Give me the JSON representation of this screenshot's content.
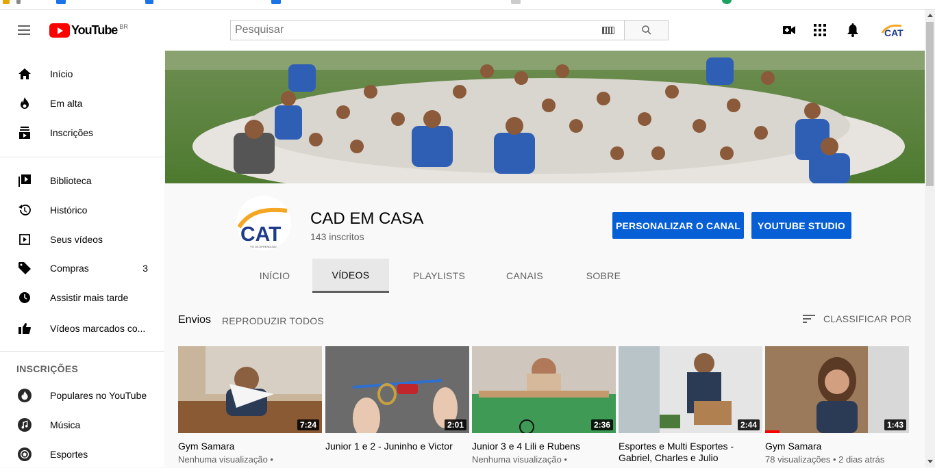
{
  "header": {
    "logo_text": "YouTube",
    "country_code": "BR",
    "search_placeholder": "Pesquisar"
  },
  "sidebar": {
    "main": [
      {
        "label": "Início",
        "icon": "home-icon"
      },
      {
        "label": "Em alta",
        "icon": "flame-icon"
      },
      {
        "label": "Inscrições",
        "icon": "subscriptions-icon"
      }
    ],
    "library": [
      {
        "label": "Biblioteca",
        "icon": "library-icon"
      },
      {
        "label": "Histórico",
        "icon": "history-icon"
      },
      {
        "label": "Seus vídeos",
        "icon": "play-square-icon"
      },
      {
        "label": "Compras",
        "icon": "tag-icon",
        "count": "3"
      },
      {
        "label": "Assistir mais tarde",
        "icon": "clock-icon"
      },
      {
        "label": "Vídeos marcados co...",
        "icon": "thumbs-up-icon"
      }
    ],
    "subscriptions_heading": "INSCRIÇÕES",
    "subscriptions": [
      {
        "label": "Populares no YouTube",
        "icon": "popular-icon"
      },
      {
        "label": "Música",
        "icon": "music-icon"
      },
      {
        "label": "Esportes",
        "icon": "sports-icon"
      }
    ]
  },
  "channel": {
    "name": "CAD EM CASA",
    "subscribers": "143 inscritos",
    "avatar_text": "CAT",
    "avatar_caption": "RO DE APRENDIZAD",
    "customize_label": "PERSONALIZAR O CANAL",
    "studio_label": "YOUTUBE STUDIO",
    "tabs": [
      "INÍCIO",
      "VÍDEOS",
      "PLAYLISTS",
      "CANAIS",
      "SOBRE"
    ],
    "active_tab": "VÍDEOS"
  },
  "uploads": {
    "title": "Envios",
    "play_all": "REPRODUZIR TODOS",
    "sort_label": "CLASSIFICAR POR",
    "videos": [
      {
        "title": "Gym Samara",
        "duration": "7:24",
        "meta": "Nenhuma visualização •"
      },
      {
        "title": "Junior 1 e 2 - Juninho e Victor",
        "duration": "2:01",
        "meta": ""
      },
      {
        "title": "Junior 3 e 4 Lili e Rubens",
        "duration": "2:36",
        "meta": "Nenhuma visualização •"
      },
      {
        "title": "Esportes e Multi Esportes - Gabriel, Charles e Julio",
        "duration": "2:44",
        "meta": ""
      },
      {
        "title": "Gym Samara",
        "duration": "1:43",
        "meta": "78 visualizações • 2 dias atrás",
        "watched_fraction": 0.1
      }
    ]
  },
  "colors": {
    "primary_button": "#065fd4",
    "youtube_red": "#ff0000"
  }
}
